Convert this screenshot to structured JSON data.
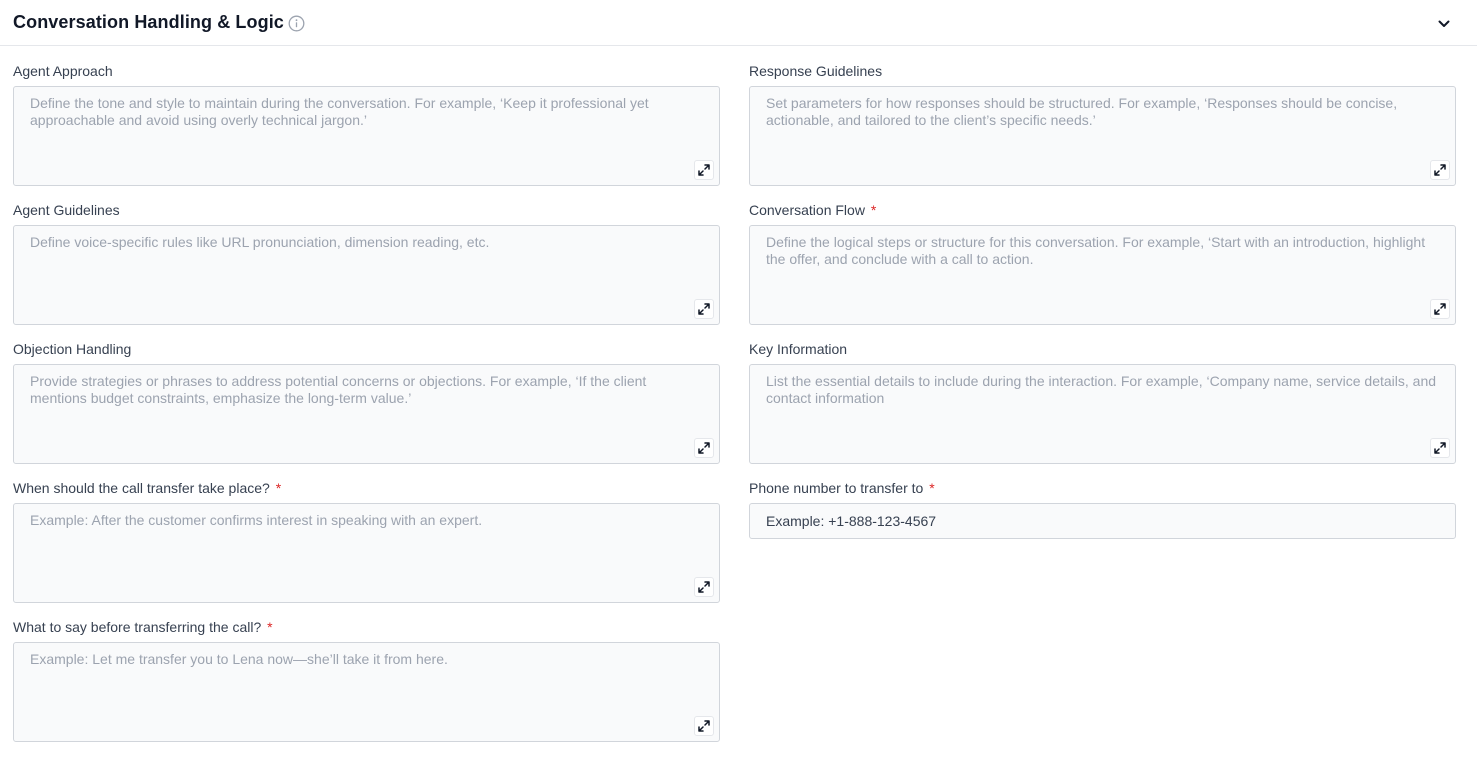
{
  "section": {
    "title": "Conversation Handling & Logic",
    "info_icon": "info-circle-icon",
    "collapse_icon": "chevron-down-icon"
  },
  "fields": {
    "agent_approach": {
      "label": "Agent Approach",
      "placeholder": "Define the tone and style to maintain during the conversation. For example, ‘Keep it professional yet approachable and avoid using overly technical jargon.’"
    },
    "response_guidelines": {
      "label": "Response Guidelines",
      "placeholder": "Set parameters for how responses should be structured. For example, ‘Responses should be concise, actionable, and tailored to the client’s specific needs.’"
    },
    "agent_guidelines": {
      "label": "Agent Guidelines",
      "placeholder": "Define voice-specific rules like URL pronunciation, dimension reading, etc."
    },
    "conversation_flow": {
      "label": "Conversation Flow",
      "required": "*",
      "placeholder": "Define the logical steps or structure for this conversation. For example, ‘Start with an introduction, highlight the offer, and conclude with a call to action."
    },
    "objection_handling": {
      "label": "Objection Handling",
      "placeholder": "Provide strategies or phrases to address potential concerns or objections. For example, ‘If the client mentions budget constraints, emphasize the long-term value.’"
    },
    "key_information": {
      "label": "Key Information",
      "placeholder": "List the essential details to include during the interaction. For example, ‘Company name, service details, and contact information"
    },
    "transfer_when": {
      "label": "When should the call transfer take place?",
      "required": "*",
      "placeholder": "Example: After the customer confirms interest in speaking with an expert."
    },
    "transfer_phone": {
      "label": "Phone number to transfer to",
      "required": "*",
      "placeholder": "Example: +1-888-123-4567"
    },
    "transfer_say": {
      "label": "What to say before transferring the call?",
      "required": "*",
      "placeholder": "Example: Let me transfer you to Lena now—she’ll take it from here."
    }
  },
  "expand_icon": "expand-icon",
  "colors": {
    "required": "#dc2626",
    "field_bg": "#f9fafb",
    "field_border": "#d1d5db",
    "placeholder": "#9ca3af"
  }
}
